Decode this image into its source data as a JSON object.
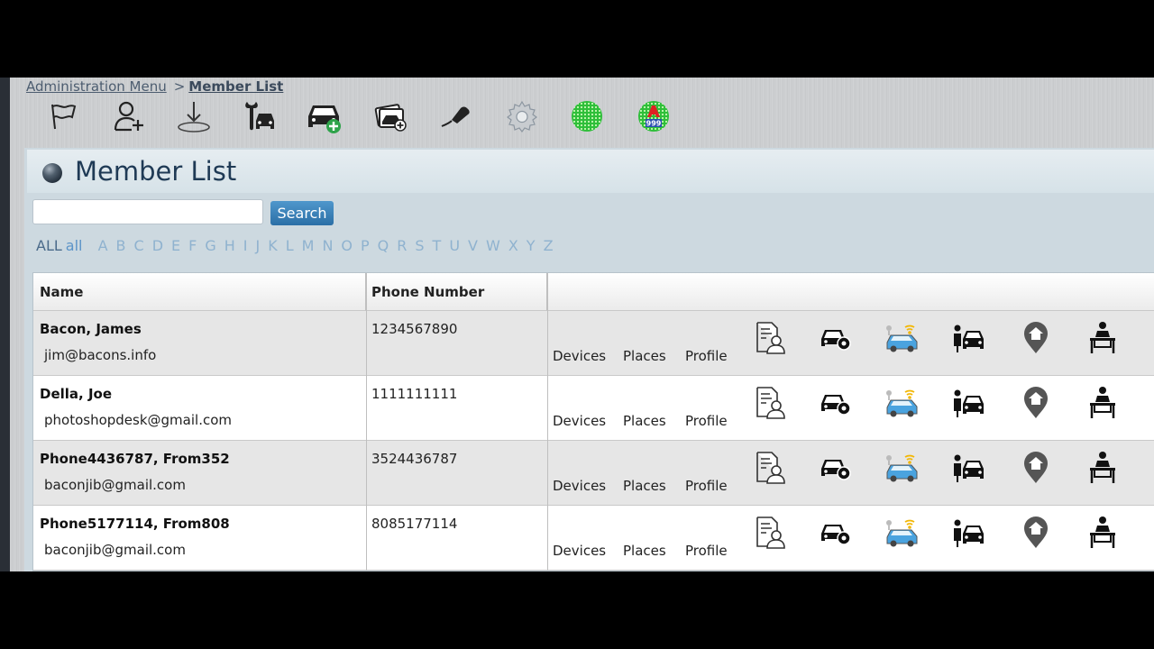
{
  "breadcrumb": {
    "parent": "Administration Menu",
    "separator": ">",
    "current": "Member List"
  },
  "toolbar": [
    {
      "name": "flag-icon"
    },
    {
      "name": "add-user-icon"
    },
    {
      "name": "download-icon"
    },
    {
      "name": "mechanic-car-icon"
    },
    {
      "name": "add-car-icon"
    },
    {
      "name": "car-photos-icon"
    },
    {
      "name": "key-fob-icon"
    },
    {
      "name": "settings-gear-icon"
    },
    {
      "name": "green-grid-icon"
    },
    {
      "name": "a999-badge-icon"
    }
  ],
  "page": {
    "title": "Member List"
  },
  "search": {
    "placeholder": "",
    "button_label": "Search"
  },
  "alpha_filter": {
    "all_upper": "ALL",
    "all_lower": "all",
    "letters": [
      "A",
      "B",
      "C",
      "D",
      "E",
      "F",
      "G",
      "H",
      "I",
      "J",
      "K",
      "L",
      "M",
      "N",
      "O",
      "P",
      "Q",
      "R",
      "S",
      "T",
      "U",
      "V",
      "W",
      "X",
      "Y",
      "Z"
    ]
  },
  "table": {
    "headers": {
      "name": "Name",
      "phone": "Phone Number"
    },
    "link_labels": {
      "devices": "Devices",
      "places": "Places",
      "profile": "Profile"
    },
    "row_icons": [
      "profile-document-icon",
      "car-settings-icon",
      "connected-car-icon",
      "driver-car-icon",
      "location-pin-icon",
      "person-desk-icon"
    ],
    "rows": [
      {
        "name": "Bacon, James",
        "email": "jim@bacons.info",
        "phone": "1234567890"
      },
      {
        "name": "Della, Joe",
        "email": "photoshopdesk@gmail.com",
        "phone": "1111111111"
      },
      {
        "name": "Phone4436787, From352",
        "email": "baconjib@gmail.com",
        "phone": "3524436787"
      },
      {
        "name": "Phone5177114, From808",
        "email": "baconjib@gmail.com",
        "phone": "8085177114"
      }
    ]
  }
}
